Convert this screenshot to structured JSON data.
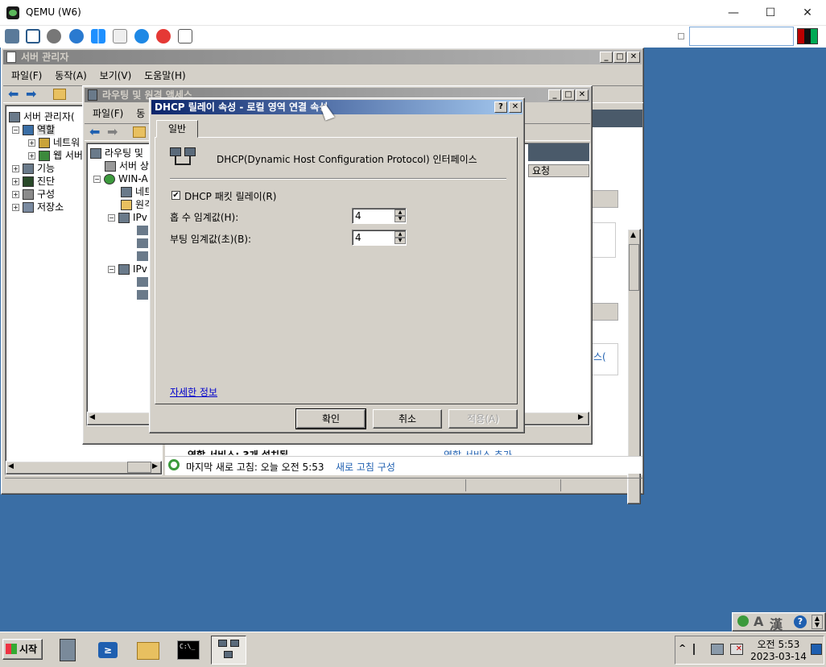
{
  "qemu": {
    "title": "QEMU (W6)",
    "controls": {
      "minimize": "—",
      "maximize": "☐",
      "close": "✕"
    }
  },
  "server_manager": {
    "title": "서버 관리자",
    "menu": [
      "파일(F)",
      "동작(A)",
      "보기(V)",
      "도움말(H)"
    ],
    "tree": [
      {
        "label": "서버 관리자(",
        "pm": ""
      },
      {
        "label": "역할",
        "pm": "⊟"
      },
      {
        "label": "네트워",
        "pm": "⊞"
      },
      {
        "label": "웹 서버",
        "pm": "⊞"
      },
      {
        "label": "기능",
        "pm": "⊞"
      },
      {
        "label": "진단",
        "pm": "⊞"
      },
      {
        "label": "구성",
        "pm": "⊞"
      },
      {
        "label": "저장소",
        "pm": "⊞"
      }
    ],
    "right_partial": {
      "col_header": "요청",
      "link_fragment": "스(",
      "roles_text": "역할 서비스: 3개 설치됨",
      "add_role_link": "역할 서비스 추가"
    },
    "status": {
      "last_refresh": "마지막 새로 고침: 오늘 오전 5:53",
      "refresh_link": "새로 고침 구성"
    }
  },
  "rras": {
    "title": "라우팅 및 원격 액세스",
    "menu": [
      "파일(F)",
      "동"
    ],
    "tree": [
      {
        "label": "라우팅 및"
      },
      {
        "label": "서버 상"
      },
      {
        "label": "WIN-A"
      },
      {
        "label": "네트"
      },
      {
        "label": "원격"
      },
      {
        "label": "IPv"
      },
      {
        "label": "IPv"
      }
    ]
  },
  "dialog": {
    "title": "DHCP 릴레이 속성 - 로컬 영역 연결 속성",
    "help_btn": "?",
    "close_btn": "✕",
    "tab": "일반",
    "interface_desc": "DHCP(Dynamic Host Configuration Protocol) 인터페이스",
    "checkbox_label": "DHCP 패킷 릴레이(R)",
    "checkbox_checked": true,
    "hop_label": "홉 수 임계값(H):",
    "hop_value": "4",
    "boot_label": "부팅 임계값(초)(B):",
    "boot_value": "4",
    "more_info": "자세한 정보",
    "ok": "확인",
    "cancel": "취소",
    "apply": "적용(A)"
  },
  "taskbar": {
    "start": "시작",
    "time": "오전 5:53",
    "date": "2023-03-14",
    "ime_a": "A",
    "ime_han": "漢",
    "tray_up": "^"
  }
}
